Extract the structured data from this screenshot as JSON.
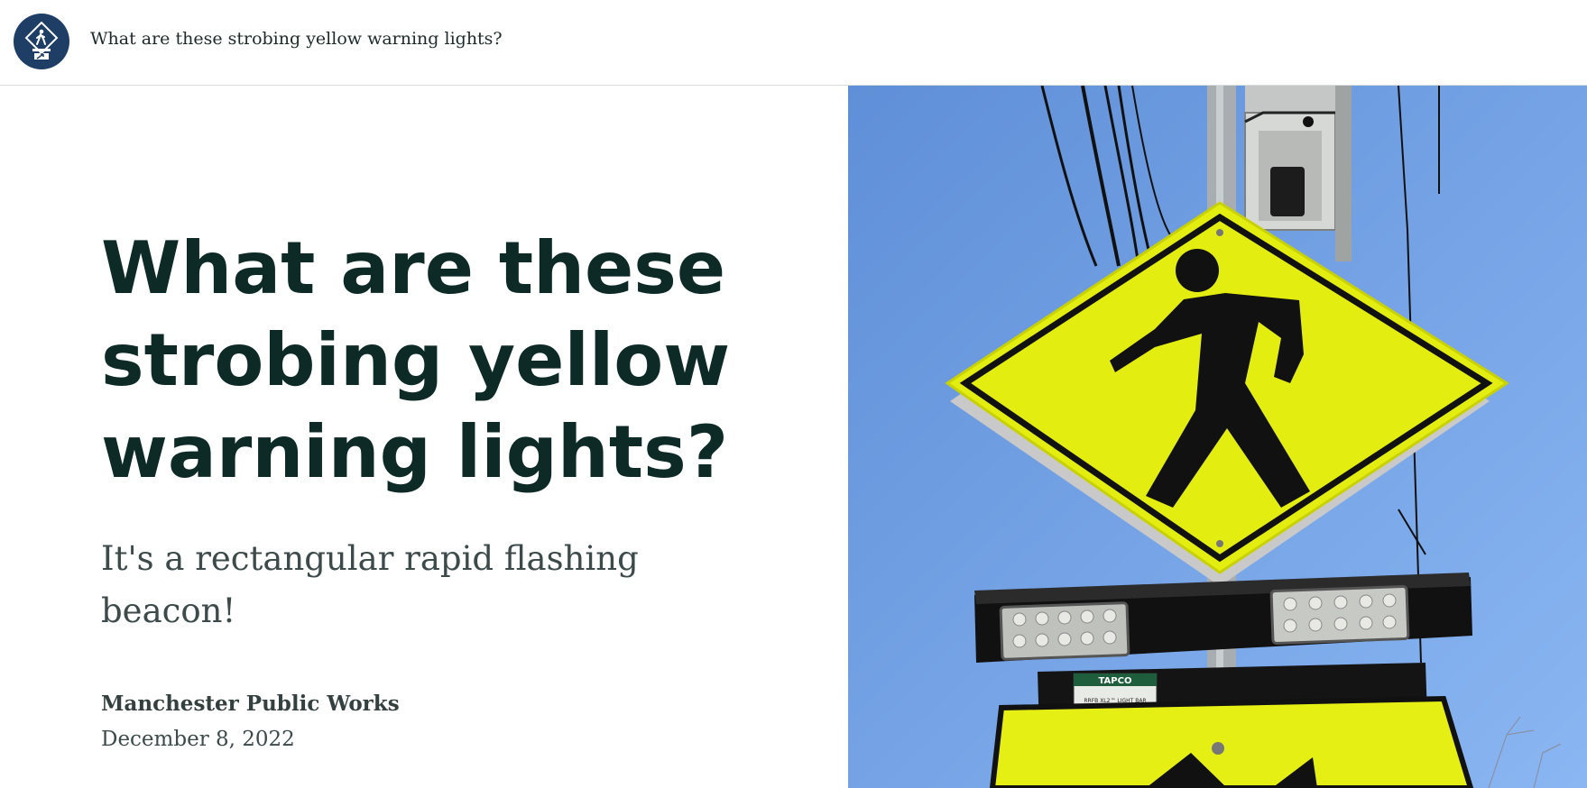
{
  "header": {
    "title": "What are these strobing yellow warning lights?",
    "logo_icon": "pedestrian-crossing-logo-icon"
  },
  "article": {
    "headline": "What are these strobing yellow warning lights?",
    "subheadline": "It's a rectangular rapid flashing beacon!",
    "author": "Manchester Public Works",
    "date": "December 8, 2022"
  },
  "hero": {
    "beacon_brand": "TAPCO",
    "beacon_label": "RRFB XL2™ LIGHT BAR"
  },
  "colors": {
    "brand_navy": "#1f3e66",
    "headline": "#0d2a26",
    "sky": "#7aa9ea",
    "sign_yellow": "#eef20a"
  }
}
